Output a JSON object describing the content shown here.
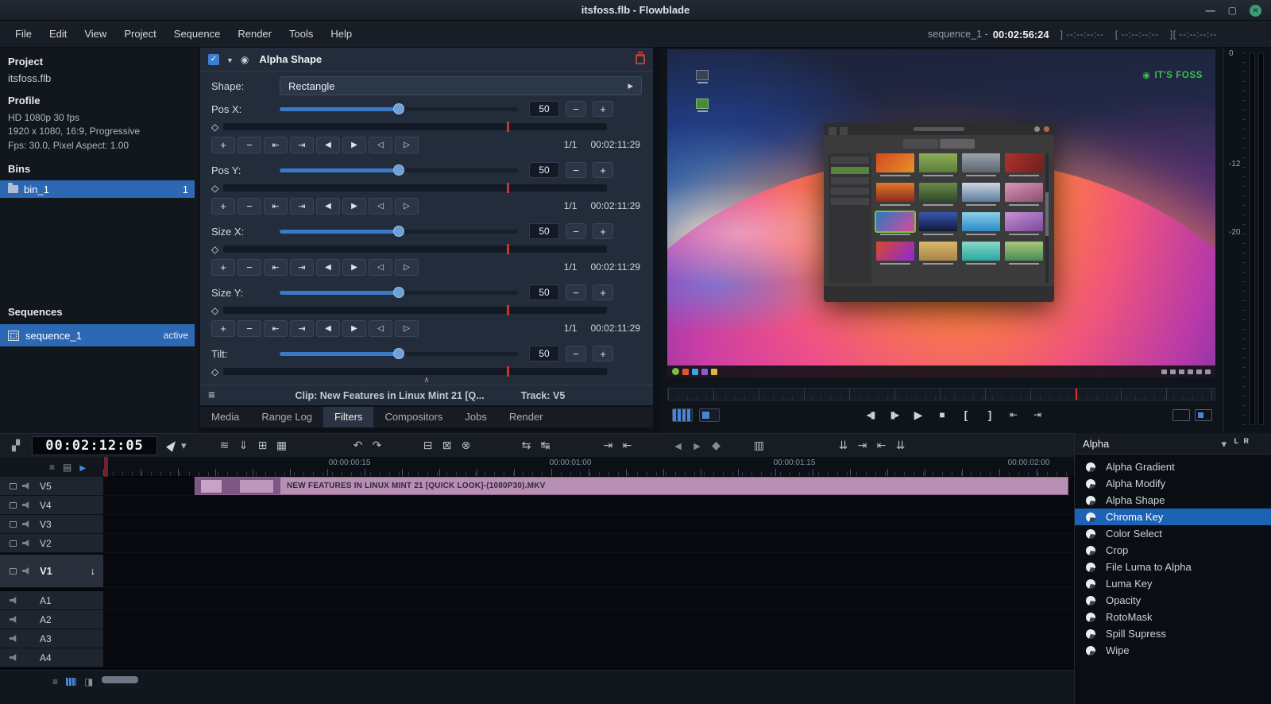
{
  "titlebar": {
    "title": "itsfoss.flb - Flowblade"
  },
  "menubar": {
    "items": [
      "File",
      "Edit",
      "View",
      "Project",
      "Sequence",
      "Render",
      "Tools",
      "Help"
    ],
    "sequence_label": "sequence_1 -",
    "timecode": "00:02:56:24",
    "mark_out": "]  --:--:--:--",
    "mark_in": "[ --:--:--:--",
    "mark_len": "][ --:--:--:--"
  },
  "project_panel": {
    "project_label": "Project",
    "project_name": "itsfoss.flb",
    "profile_label": "Profile",
    "profile_line1": "HD 1080p 30 fps",
    "profile_line2": "1920 x 1080, 16:9, Progressive",
    "profile_line3": "Fps: 30.0, Pixel Aspect: 1.00",
    "bins_label": "Bins",
    "bin_name": "bin_1",
    "bin_count": "1",
    "sequences_label": "Sequences",
    "sequence_name": "sequence_1",
    "sequence_status": "active"
  },
  "filter_editor": {
    "title": "Alpha Shape",
    "shape_label": "Shape:",
    "shape_value": "Rectangle",
    "params": [
      {
        "label": "Pos X:",
        "value": "50"
      },
      {
        "label": "Pos Y:",
        "value": "50"
      },
      {
        "label": "Size X:",
        "value": "50"
      },
      {
        "label": "Size Y:",
        "value": "50"
      },
      {
        "label": "Tilt:",
        "value": "50"
      }
    ],
    "kf_count": "1/1",
    "kf_timecode": "00:02:11:29",
    "clip_info": "Clip: New Features in Linux Mint 21 [Q...",
    "track_info": "Track: V5"
  },
  "panel_tabs": {
    "items": [
      "Media",
      "Range Log",
      "Filters",
      "Compositors",
      "Jobs",
      "Render"
    ],
    "active": "Filters"
  },
  "monitor": {
    "watermark": "IT'S FOSS",
    "meter_labels": [
      "0",
      "-12",
      "-20"
    ],
    "lr_label": "L R"
  },
  "timeline": {
    "timecode": "00:02:12:05",
    "ruler_marks": [
      "00:00:00:15",
      "00:00:01:00",
      "00:00:01:15",
      "00:00:02:00"
    ],
    "video_tracks": [
      "V5",
      "V4",
      "V3",
      "V2",
      "V1"
    ],
    "audio_tracks": [
      "A1",
      "A2",
      "A3",
      "A4"
    ],
    "clip_label": "NEW FEATURES IN LINUX MINT 21 [QUICK LOOK]-(1080P30).MKV"
  },
  "filter_select": {
    "group": "Alpha",
    "items": [
      "Alpha Gradient",
      "Alpha Modify",
      "Alpha Shape",
      "Chroma Key",
      "Color Select",
      "Crop",
      "File Luma to Alpha",
      "Luma Key",
      "Opacity",
      "RotoMask",
      "Spill Supress",
      "Wipe"
    ],
    "selected": "Chroma Key"
  },
  "icons": {
    "keyframe_buttons": [
      "kf-add",
      "kf-delete",
      "kf-prev",
      "kf-next",
      "prev-frame",
      "next-frame",
      "kf-slip-prev",
      "kf-slip-next"
    ],
    "toolbar": [
      "clapper",
      "pointer-tool",
      "source-levels",
      "insert-overwrite",
      "append",
      "range-overwrite",
      "undo",
      "redo",
      "splice-out",
      "lift",
      "delete-range",
      "resync",
      "split-audio",
      "marker-next",
      "marker-prev",
      "trim-left",
      "trim-right",
      "roll",
      "multitrim",
      "sync"
    ],
    "transport": [
      "prev-frame",
      "next-frame",
      "play",
      "stop",
      "mark-in",
      "mark-out",
      "to-mark-in",
      "to-mark-out"
    ]
  },
  "colors": {
    "accent_blue": "#3c78c8",
    "selection_blue": "#2d68b5",
    "clip_pink": "#b78fb2",
    "playhead_red": "#c4372b",
    "logo_green": "#35c83f"
  }
}
